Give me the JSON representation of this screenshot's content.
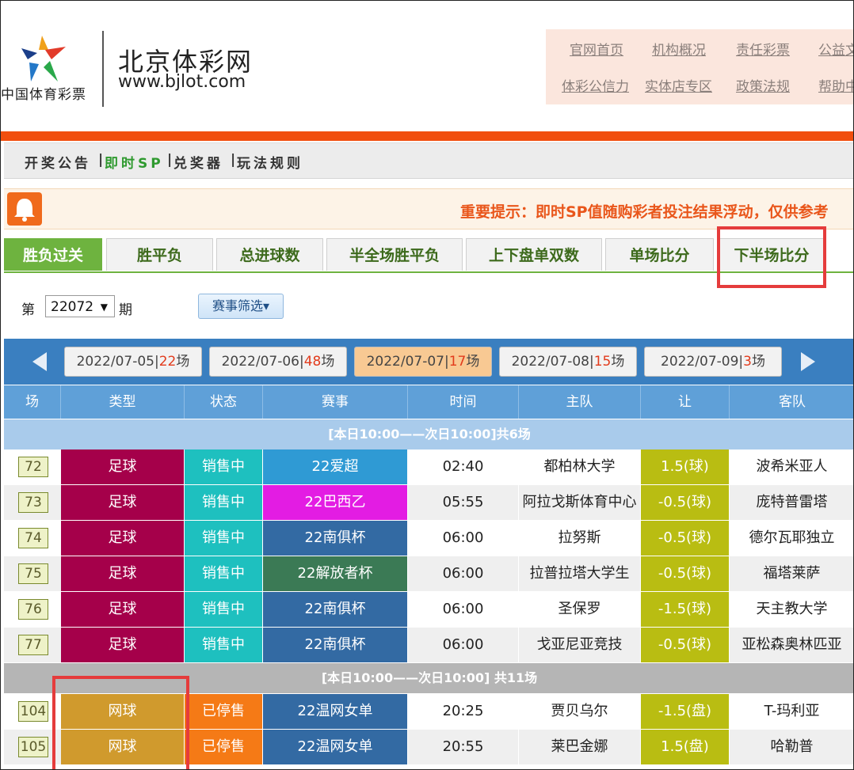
{
  "header": {
    "logo_cn": "中国体育彩票",
    "site_title": "北京体彩网",
    "site_url": "www.bjlot.com",
    "top_links_row1": [
      "官网首页",
      "机构概况",
      "责任彩票",
      "公益文"
    ],
    "top_links_row2": [
      "体彩公信力",
      "实体店专区",
      "政策法规",
      "帮助中"
    ]
  },
  "subnav": {
    "item1": "开奖公告",
    "item2": "即时SP",
    "item3": "兑奖器",
    "item4": "玩法规则",
    "sep": "|"
  },
  "notice": {
    "text": "重要提示：即时SP值随购彩者投注结果浮动，仅供参考"
  },
  "tabs": [
    "胜负过关",
    "胜平负",
    "总进球数",
    "半全场胜平负",
    "上下盘单双数",
    "单场比分",
    "下半场比分"
  ],
  "period": {
    "label_prefix": "第",
    "value": "22072",
    "arrow": "▼",
    "label_suffix": "期"
  },
  "filter_button": {
    "label": "赛事筛选",
    "arrow": "▾"
  },
  "dates": [
    {
      "date": "2022/07-05|",
      "count": "22",
      "unit": "场"
    },
    {
      "date": "2022/07-06|",
      "count": "48",
      "unit": "场"
    },
    {
      "date": "2022/07-07|",
      "count": "17",
      "unit": "场"
    },
    {
      "date": "2022/07-08|",
      "count": "15",
      "unit": "场"
    },
    {
      "date": "2022/07-09|",
      "count": "3",
      "unit": "场"
    }
  ],
  "table": {
    "headers": [
      "场",
      "类型",
      "状态",
      "赛事",
      "时间",
      "主队",
      "让",
      "客队"
    ],
    "section1": "[本日10:00——次日10:00]共6场",
    "section2": "[本日10:00——次日10:00] 共11场",
    "rows": [
      {
        "no": "72",
        "type": "足球",
        "status": "销售中",
        "league": "22爱超",
        "time": "02:40",
        "home": "都柏林大学",
        "handicap": "1.5(球)",
        "away": "波希米亚人"
      },
      {
        "no": "73",
        "type": "足球",
        "status": "销售中",
        "league": "22巴西乙",
        "time": "05:55",
        "home": "阿拉戈斯体育中心",
        "handicap": "-0.5(球)",
        "away": "庞特普雷塔"
      },
      {
        "no": "74",
        "type": "足球",
        "status": "销售中",
        "league": "22南俱杯",
        "time": "06:00",
        "home": "拉努斯",
        "handicap": "-0.5(球)",
        "away": "德尔瓦耶独立"
      },
      {
        "no": "75",
        "type": "足球",
        "status": "销售中",
        "league": "22解放者杯",
        "time": "06:00",
        "home": "拉普拉塔大学生",
        "handicap": "-0.5(球)",
        "away": "福塔莱萨"
      },
      {
        "no": "76",
        "type": "足球",
        "status": "销售中",
        "league": "22南俱杯",
        "time": "06:00",
        "home": "圣保罗",
        "handicap": "-1.5(球)",
        "away": "天主教大学"
      },
      {
        "no": "77",
        "type": "足球",
        "status": "销售中",
        "league": "22南俱杯",
        "time": "06:00",
        "home": "戈亚尼亚竞技",
        "handicap": "-0.5(球)",
        "away": "亚松森奥林匹亚"
      },
      {
        "no": "104",
        "type": "网球",
        "status": "已停售",
        "league": "22温网女单",
        "time": "20:25",
        "home": "贾贝乌尔",
        "handicap": "-1.5(盘)",
        "away": "T-玛利亚"
      },
      {
        "no": "105",
        "type": "网球",
        "status": "已停售",
        "league": "22温网女单",
        "time": "20:55",
        "home": "莱巴金娜",
        "handicap": "1.5(盘)",
        "away": "哈勒普"
      }
    ]
  },
  "colors": {
    "soccer": "#a5004a",
    "tennis": "#d09a2d",
    "selling": "#1ec0bf",
    "stopped": "#f57a16",
    "league_aichao": "#2f9ad4",
    "league_baxi": "#e31ce3",
    "league_nanju": "#336aa3",
    "league_jiefang": "#3b7a55",
    "handicap": "#b9bd12",
    "accent_orange": "#f14e0e"
  }
}
